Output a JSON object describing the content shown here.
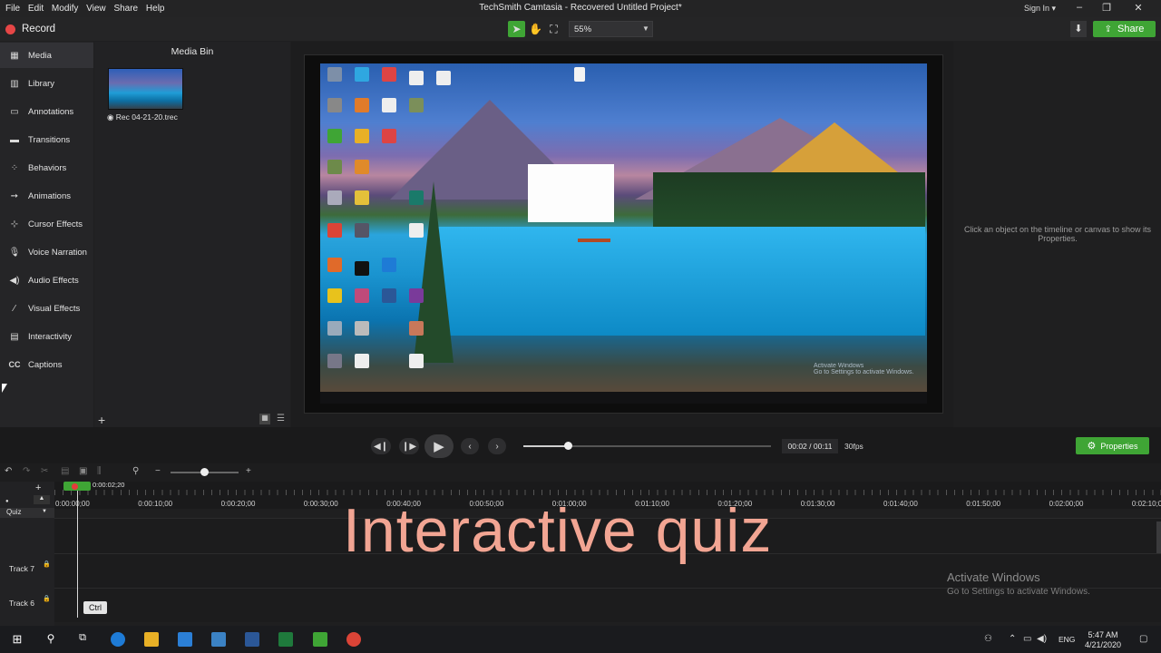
{
  "menu": [
    "File",
    "Edit",
    "Modify",
    "View",
    "Share",
    "Help"
  ],
  "window_title": "TechSmith Camtasia - Recovered  Untitled Project*",
  "sign_in": "Sign In ▾",
  "toolbar": {
    "record_label": "Record",
    "zoom": "55%",
    "share_label": "Share"
  },
  "sidebar": {
    "items": [
      {
        "label": "Media",
        "icon": "film-icon"
      },
      {
        "label": "Library",
        "icon": "library-icon"
      },
      {
        "label": "Annotations",
        "icon": "annotation-icon"
      },
      {
        "label": "Transitions",
        "icon": "transition-icon"
      },
      {
        "label": "Behaviors",
        "icon": "behavior-icon"
      },
      {
        "label": "Animations",
        "icon": "animation-icon"
      },
      {
        "label": "Cursor Effects",
        "icon": "cursor-icon"
      },
      {
        "label": "Voice Narration",
        "icon": "microphone-icon"
      },
      {
        "label": "Audio Effects",
        "icon": "speaker-icon"
      },
      {
        "label": "Visual Effects",
        "icon": "wand-icon"
      },
      {
        "label": "Interactivity",
        "icon": "interactivity-icon"
      },
      {
        "label": "Captions",
        "icon": "cc-icon"
      }
    ]
  },
  "media_bin": {
    "title": "Media Bin",
    "clip_name": "Rec 04-21-20.trec"
  },
  "properties": {
    "hint": "Click an object on the timeline or canvas to show its Properties.",
    "button": "Properties"
  },
  "playback": {
    "timecode": "00:02 / 00:11",
    "fps": "30fps",
    "progress": 0.18
  },
  "timeline": {
    "playhead_time": "0:00:02;20",
    "ticks": [
      "0:00:00;00",
      "0:00:10;00",
      "0:00:20;00",
      "0:00:30;00",
      "0:00:40;00",
      "0:00:50;00",
      "0:01:00;00",
      "0:01:10;00",
      "0:01:20;00",
      "0:01:30;00",
      "0:01:40;00",
      "0:01:50;00",
      "0:02:00;00",
      "0:02:10;00"
    ],
    "quiz_label": "Quiz",
    "tracks": [
      "Track 7",
      "Track 6"
    ],
    "key_hint": "Ctrl"
  },
  "overlay_caption": "Interactive quiz",
  "activation": {
    "title": "Activate Windows",
    "subtitle": "Go to Settings to activate Windows.",
    "small_title": "Activate Windows",
    "small_sub": "Go to Settings to activate Windows."
  },
  "taskbar": {
    "lang": "ENG",
    "time": "5:47 AM",
    "date": "4/21/2020"
  },
  "colors": {
    "accent_green": "#3fa535",
    "record_red": "#e64646",
    "caption_color": "#f2a593"
  }
}
